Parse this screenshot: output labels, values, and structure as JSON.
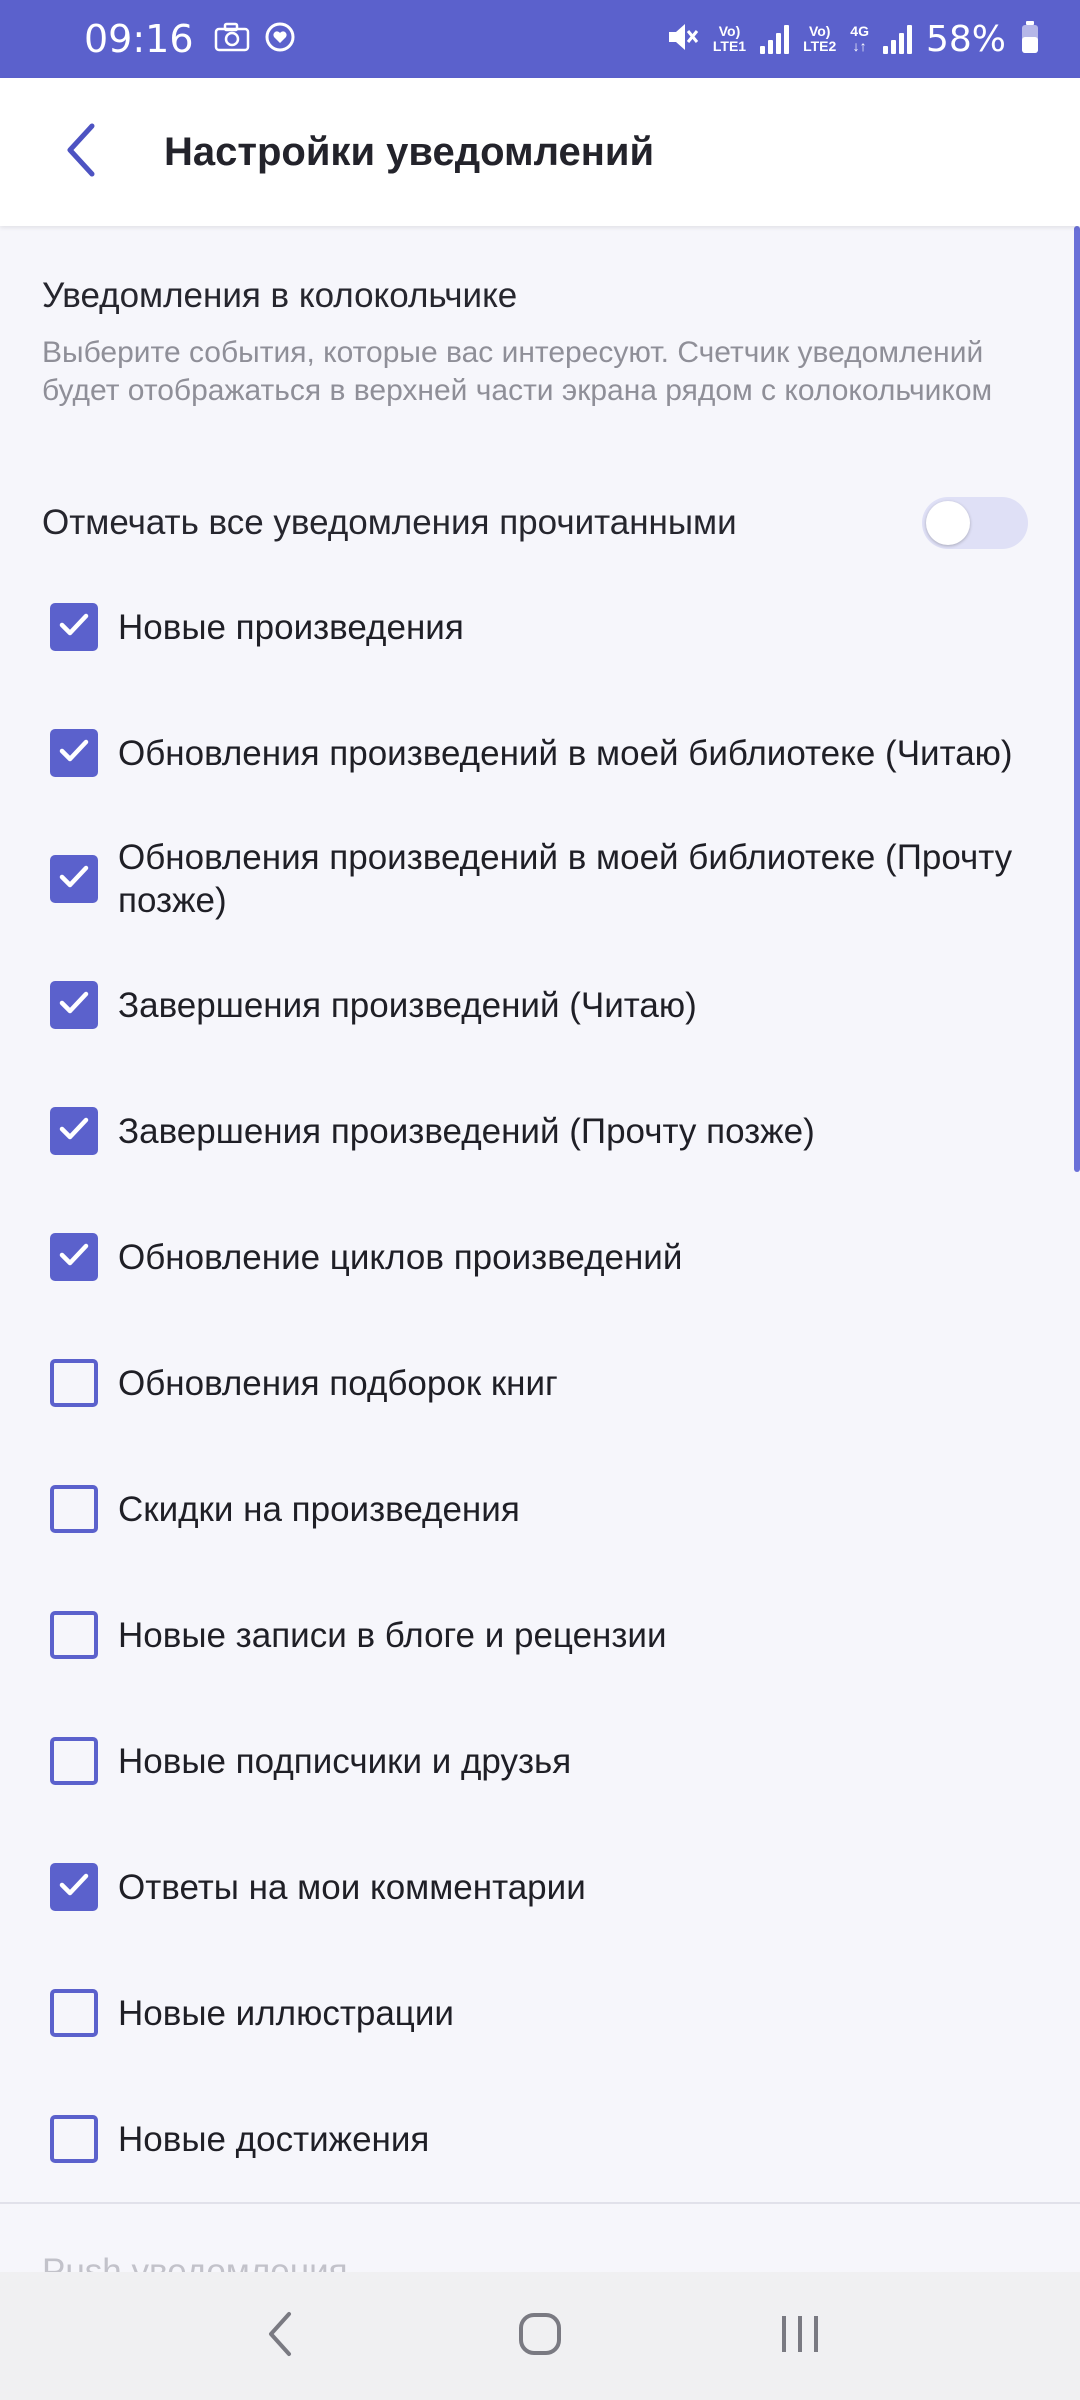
{
  "status_bar": {
    "time": "09:16",
    "battery": "58%",
    "sim1_label_top": "Vo)",
    "sim1_label_bottom": "LTE1",
    "sim2_label_top": "Vo)",
    "sim2_label_bottom": "LTE2",
    "network_type": "4G"
  },
  "app_bar": {
    "title": "Настройки уведомлений"
  },
  "bell_section": {
    "title": "Уведомления в колокольчике",
    "description": "Выберите события, которые вас интересуют. Счетчик уведомлений будет отображаться в верхней части экрана рядом с колокольчиком",
    "mark_all_read_label": "Отмечать все уведомления прочитанными",
    "mark_all_read_on": false
  },
  "options": [
    {
      "label": "Новые произведения",
      "checked": true
    },
    {
      "label": "Обновления произведений в моей библиотеке (Читаю)",
      "checked": true
    },
    {
      "label": "Обновления произведений в моей библиотеке (Прочту позже)",
      "checked": true
    },
    {
      "label": "Завершения произведений (Читаю)",
      "checked": true
    },
    {
      "label": "Завершения произведений (Прочту позже)",
      "checked": true
    },
    {
      "label": "Обновление циклов произведений",
      "checked": true
    },
    {
      "label": "Обновления подборок книг",
      "checked": false
    },
    {
      "label": "Скидки на произведения",
      "checked": false
    },
    {
      "label": "Новые записи в блоге и рецензии",
      "checked": false
    },
    {
      "label": "Новые подписчики и друзья",
      "checked": false
    },
    {
      "label": "Ответы на мои комментарии",
      "checked": true
    },
    {
      "label": "Новые иллюстрации",
      "checked": false
    },
    {
      "label": "Новые достижения",
      "checked": false
    }
  ],
  "next_section_title": "Push уведомления",
  "colors": {
    "accent": "#5b61cc",
    "background": "#f6f6fb",
    "toggle_track": "#dfe0f6"
  }
}
